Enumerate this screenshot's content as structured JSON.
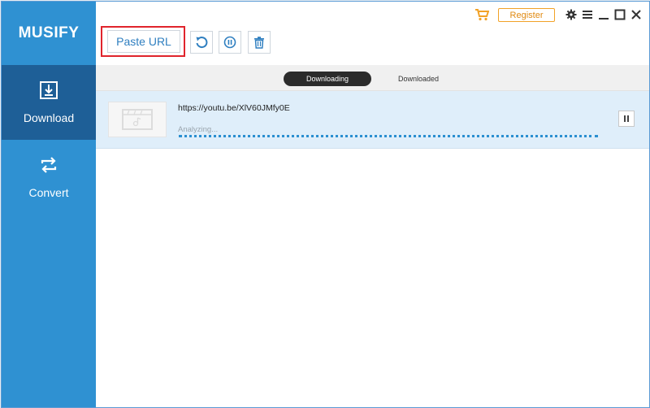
{
  "app": {
    "name": "MUSIFY"
  },
  "sidebar": {
    "items": [
      {
        "label": "Download",
        "icon": "download-icon",
        "active": true
      },
      {
        "label": "Convert",
        "icon": "convert-icon",
        "active": false
      }
    ]
  },
  "toolbar": {
    "paste_label": "Paste URL",
    "register_label": "Register",
    "buttons": [
      "refresh-icon",
      "pause-all-icon",
      "delete-icon"
    ]
  },
  "tabs": [
    {
      "label": "Downloading",
      "active": true
    },
    {
      "label": "Downloaded",
      "active": false
    }
  ],
  "downloads": [
    {
      "url": "https://youtu.be/XlV60JMfy0E",
      "status": "Analyzing..."
    }
  ],
  "colors": {
    "sidebar": "#2f91d2",
    "sidebar_active": "#1e5f97",
    "accent": "#2f7fc0",
    "register": "#f2a227",
    "highlight": "#e0242c",
    "row_bg": "#dfeefa"
  }
}
